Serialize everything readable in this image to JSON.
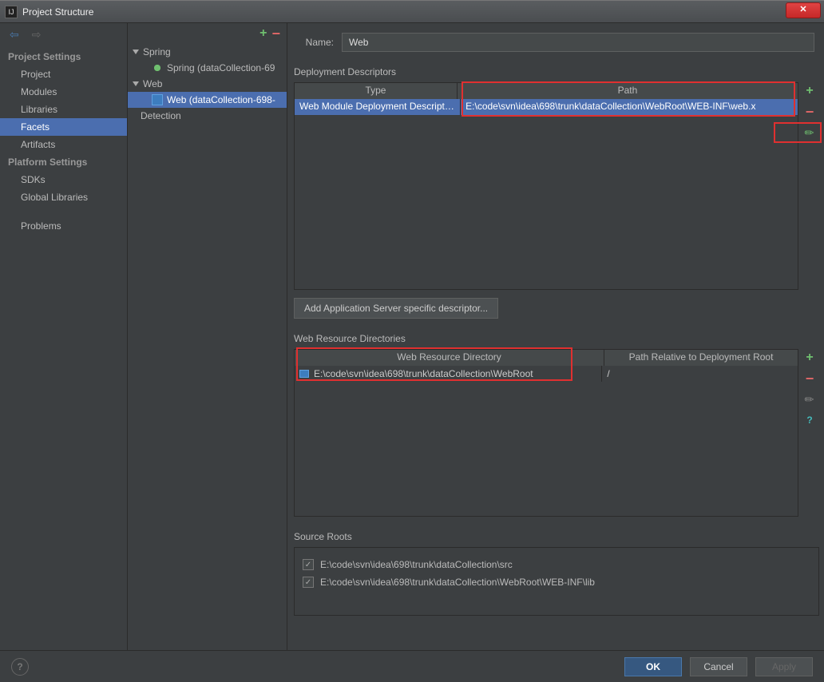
{
  "dialog": {
    "title": "Project Structure"
  },
  "sidebar": {
    "section1": "Project Settings",
    "items1": [
      "Project",
      "Modules",
      "Libraries",
      "Facets",
      "Artifacts"
    ],
    "section2": "Platform Settings",
    "items2": [
      "SDKs",
      "Global Libraries"
    ],
    "items3": [
      "Problems"
    ]
  },
  "tree": {
    "spring": "Spring",
    "spring_child": "Spring (dataCollection-69",
    "web": "Web",
    "web_child": "Web (dataCollection-698-",
    "detection": "Detection"
  },
  "form": {
    "name_label": "Name:",
    "name_value": "Web"
  },
  "deploy": {
    "title": "Deployment Descriptors",
    "col_type": "Type",
    "col_path": "Path",
    "row_type": "Web Module Deployment Descript…",
    "row_path": "E:\\code\\svn\\idea\\698\\trunk\\dataCollection\\WebRoot\\WEB-INF\\web.x",
    "add_btn": "Add Application Server specific descriptor..."
  },
  "wrd": {
    "title": "Web Resource Directories",
    "col1": "Web Resource Directory",
    "col2": "Path Relative to Deployment Root",
    "row_dir": "E:\\code\\svn\\idea\\698\\trunk\\dataCollection\\WebRoot",
    "row_path": "/"
  },
  "src": {
    "title": "Source Roots",
    "root1": "E:\\code\\svn\\idea\\698\\trunk\\dataCollection\\src",
    "root2": "E:\\code\\svn\\idea\\698\\trunk\\dataCollection\\WebRoot\\WEB-INF\\lib"
  },
  "buttons": {
    "ok": "OK",
    "cancel": "Cancel",
    "apply": "Apply"
  }
}
